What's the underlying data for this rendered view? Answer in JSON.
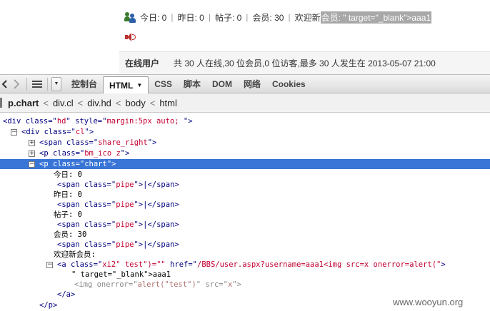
{
  "forum": {
    "stats": {
      "today": "今日: 0",
      "yesterday": "昨日: 0",
      "posts": "帖子: 0",
      "members": "会员: 30",
      "welcome_prefix": "欢迎新",
      "welcome_selected": "会员: \" target=\"_blank\">aaa1"
    },
    "online": {
      "title": "在线用户",
      "text": "共 30 人在线,30 位会员,0 位访客,最多 30 人发生在 2013-05-07 21:00"
    }
  },
  "toolbar": {
    "tabs": [
      "控制台",
      "HTML",
      "CSS",
      "脚本",
      "DOM",
      "网络",
      "Cookies"
    ],
    "active_tab": "HTML"
  },
  "breadcrumb": {
    "items": [
      "p.chart",
      "div.cl",
      "div.hd",
      "body",
      "html"
    ],
    "separator": "<"
  },
  "tree": {
    "l1": {
      "open": "<div class=\"",
      "cls": "hd",
      "mid": "\" style=\"",
      "style": "margin:5px auto; ",
      "close": "\">"
    },
    "l2": {
      "open": "<div class=\"",
      "cls": "cl",
      "close": "\">"
    },
    "l3": {
      "open": "<span class=\"",
      "cls": "share_right",
      "close": "\">"
    },
    "l4": {
      "open": "<p class=\"",
      "cls": "bm_ico z",
      "close": "\">"
    },
    "l5": {
      "text": "<p class=\"chart\">"
    },
    "today": "今日: 0",
    "yesterday": "昨日: 0",
    "posts": "帖子: 0",
    "members": "会员: 30",
    "pipe": {
      "open": "<span class=\"",
      "cls": "pipe",
      "close": "\">|</span>"
    },
    "welcome": "欢迎新会员:",
    "a_line": {
      "open": "<a class=\"",
      "cls": "xi2\" test\")=\"\"",
      "mid": " href=\"",
      "href": "/BBS/user.aspx?username=aaa1<img src=x onerror=alert(\"",
      "close": ">"
    },
    "a_cont": "\" target=\"_blank\">aaa1",
    "img_line": {
      "open": "<img ",
      "attr1": "onerror=\"",
      "val1": "alert(\"test\")",
      "mid": "\" src=\"",
      "val2": "x",
      "close": "\">"
    },
    "a_end": "</a>",
    "p_end": "</p>"
  },
  "watermark": "www.wooyun.org"
}
